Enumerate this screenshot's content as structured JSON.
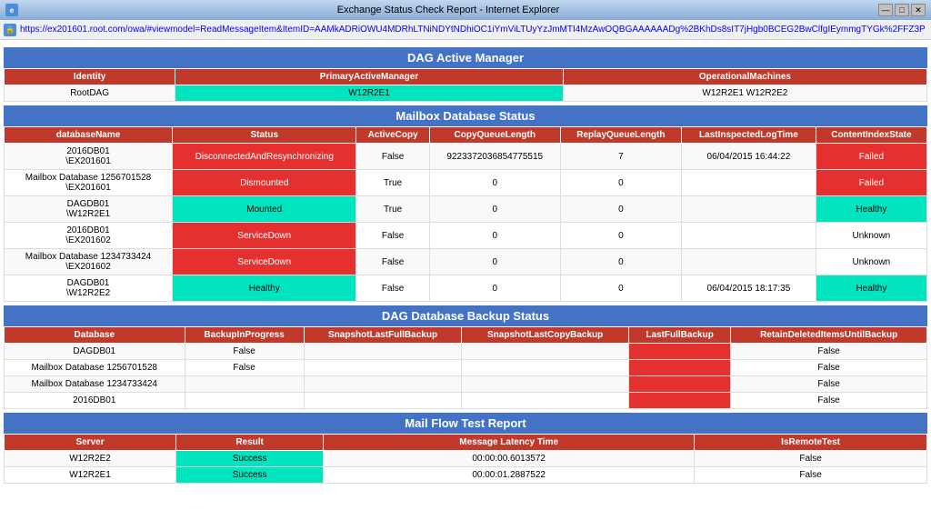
{
  "titleBar": {
    "title": "Exchange Status Check Report - Internet Explorer",
    "winControls": [
      "—",
      "□",
      "✕"
    ]
  },
  "addressBar": {
    "url": "https://ex201601.root.com/owa/#viewmodel=ReadMessageItem&ItemID=AAMkADRiOWU4MDRhLTNiNDYtNDhiOC1iYmViLTUyYzJmMTI4MzAwOQBGAAAAAADg%2BKhDs8sIT7jHgb0BCEG2BwClfgIEymmgTYGk%2FFZ3P"
  },
  "dagSection": {
    "header": "DAG Active Manager",
    "columns": [
      "Identity",
      "PrimaryActiveManager",
      "OperationalMachines"
    ],
    "rows": [
      {
        "identity": "RootDAG",
        "primaryActiveManager": "W12R2E1",
        "operationalMachines": "W12R2E1 W12R2E2"
      }
    ]
  },
  "mailboxSection": {
    "header": "Mailbox Database Status",
    "columns": [
      "databaseName",
      "Status",
      "ActiveCopy",
      "CopyQueueLength",
      "ReplayQueueLength",
      "LastInspectedLogTime",
      "ContentIndexState"
    ],
    "rows": [
      {
        "databaseName": "2016DB01\\EX201601",
        "status": "DisconnectedAndResynchronizing",
        "statusType": "red",
        "activeCopy": "False",
        "copyQueueLength": "9223372036854775515",
        "replayQueueLength": "7",
        "lastInspectedLogTime": "06/04/2015 16:44:22",
        "contentIndexState": "Failed",
        "contentType": "failed"
      },
      {
        "databaseName": "Mailbox Database 1256701528 \\EX201601",
        "status": "Dismounted",
        "statusType": "red",
        "activeCopy": "True",
        "copyQueueLength": "0",
        "replayQueueLength": "0",
        "lastInspectedLogTime": "",
        "contentIndexState": "Failed",
        "contentType": "failed"
      },
      {
        "databaseName": "DAGDB01\\W12R2E1",
        "status": "Mounted",
        "statusType": "green",
        "activeCopy": "True",
        "copyQueueLength": "0",
        "replayQueueLength": "0",
        "lastInspectedLogTime": "",
        "contentIndexState": "Healthy",
        "contentType": "healthy"
      },
      {
        "databaseName": "2016DB01\\EX201602",
        "status": "ServiceDown",
        "statusType": "red",
        "activeCopy": "False",
        "copyQueueLength": "0",
        "replayQueueLength": "0",
        "lastInspectedLogTime": "",
        "contentIndexState": "Unknown",
        "contentType": "unknown"
      },
      {
        "databaseName": "Mailbox Database 1234733424 \\EX201602",
        "status": "ServiceDown",
        "statusType": "red",
        "activeCopy": "False",
        "copyQueueLength": "0",
        "replayQueueLength": "0",
        "lastInspectedLogTime": "",
        "contentIndexState": "Unknown",
        "contentType": "unknown"
      },
      {
        "databaseName": "DAGDB01\\W12R2E2",
        "status": "Healthy",
        "statusType": "green",
        "activeCopy": "False",
        "copyQueueLength": "0",
        "replayQueueLength": "0",
        "lastInspectedLogTime": "06/04/2015 18:17:35",
        "contentIndexState": "Healthy",
        "contentType": "healthy"
      }
    ]
  },
  "backupSection": {
    "header": "DAG Database Backup Status",
    "columns": [
      "Database",
      "BackupInProgress",
      "SnapshotLastFullBackup",
      "SnapshotLastCopyBackup",
      "LastFullBackup",
      "RetainDeletedItemsUntilBackup"
    ],
    "rows": [
      {
        "database": "DAGDB01",
        "backupInProgress": "False",
        "snapshotFull": "",
        "snapshotCopy": "",
        "lastFull": "red",
        "retainDeleted": "False"
      },
      {
        "database": "Mailbox Database 1256701528",
        "backupInProgress": "False",
        "snapshotFull": "",
        "snapshotCopy": "",
        "lastFull": "red",
        "retainDeleted": "False"
      },
      {
        "database": "Mailbox Database 1234733424",
        "backupInProgress": "",
        "snapshotFull": "",
        "snapshotCopy": "",
        "lastFull": "red",
        "retainDeleted": "False"
      },
      {
        "database": "2016DB01",
        "backupInProgress": "",
        "snapshotFull": "",
        "snapshotCopy": "",
        "lastFull": "red",
        "retainDeleted": "False"
      }
    ]
  },
  "mailFlowSection": {
    "header": "Mail Flow Test Report",
    "columns": [
      "Server",
      "Result",
      "Message Latency Time",
      "IsRemoteTest"
    ],
    "rows": [
      {
        "server": "W12R2E2",
        "result": "Success",
        "resultType": "success",
        "latency": "00:00:00.6013572",
        "isRemoteTest": "False"
      },
      {
        "server": "W12R2E1",
        "result": "Success",
        "resultType": "success",
        "latency": "00:00:01.2887522",
        "isRemoteTest": "False"
      }
    ]
  }
}
